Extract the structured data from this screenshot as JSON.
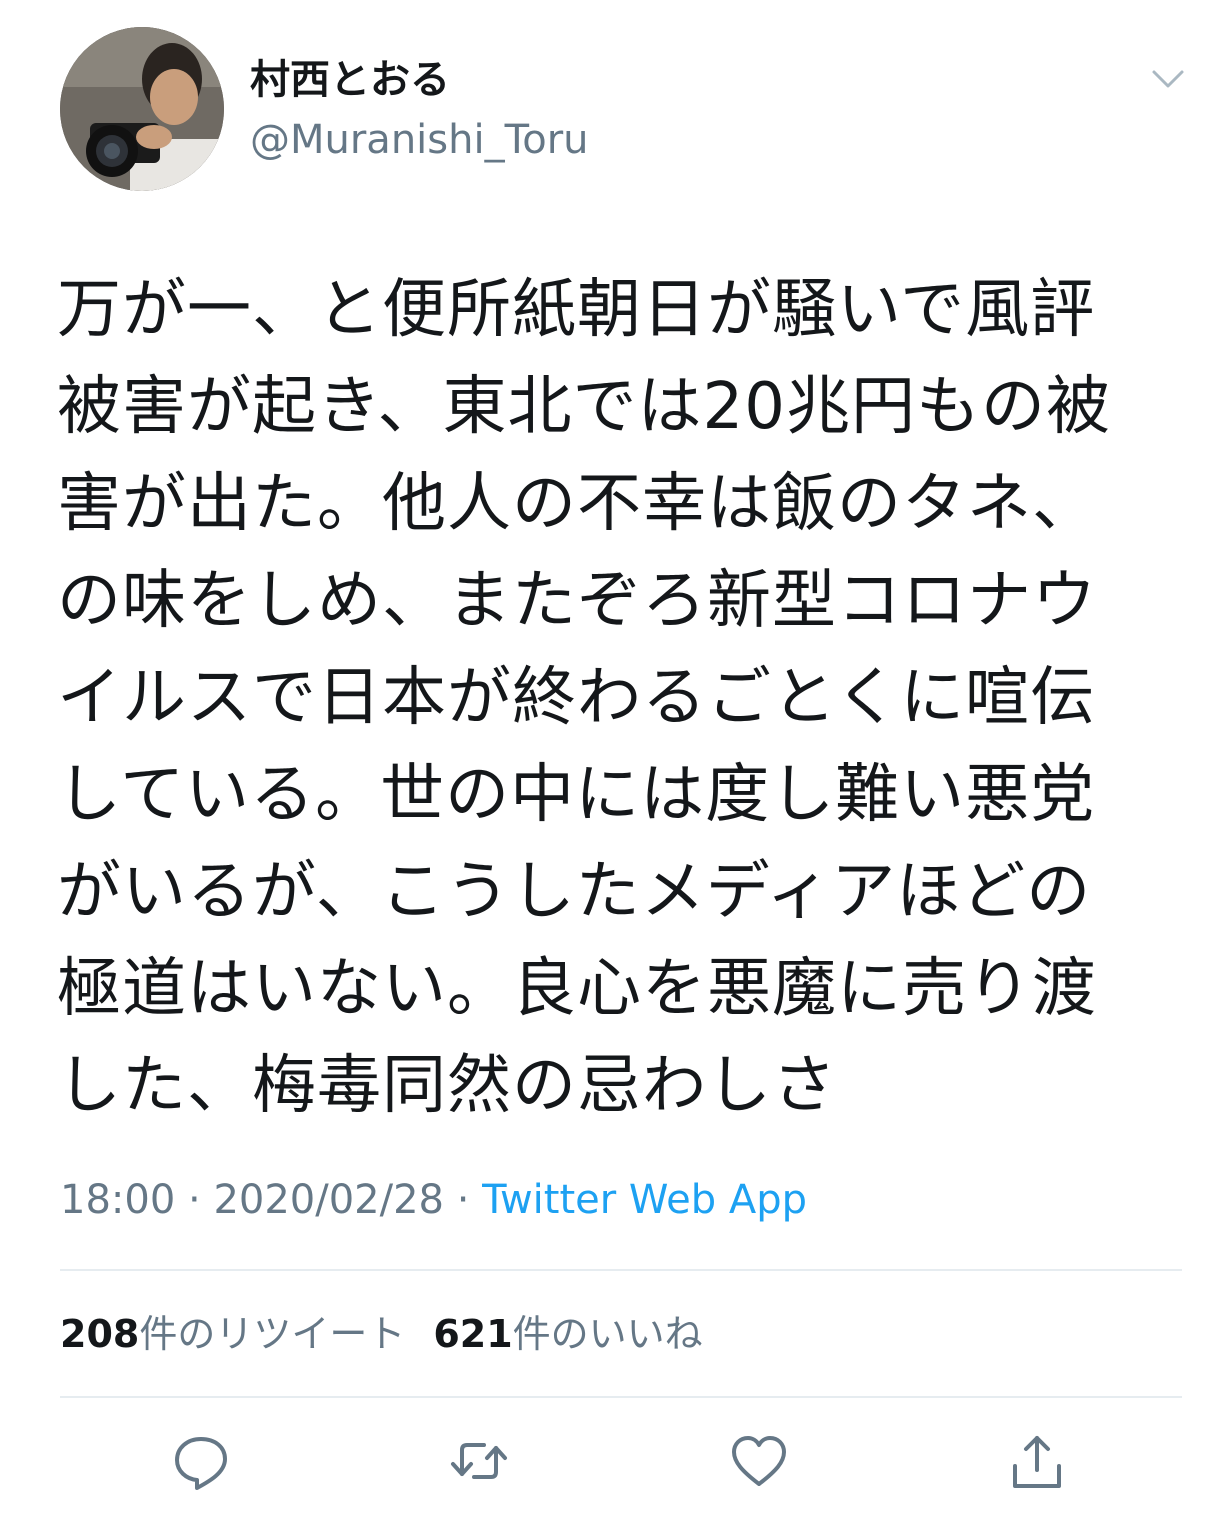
{
  "author": {
    "display_name": "村西とおる",
    "handle": "@Muranishi_Toru",
    "avatar_icon": "profile-photo-photographer-with-camera"
  },
  "menu_icon": "chevron-down-icon",
  "tweet": {
    "lines": [
      "万が一、と便所紙朝日が騒いで風評",
      "被害が起き、東北では20兆円もの被",
      "害が出た。他人の不幸は飯のタネ、",
      "の味をしめ、またぞろ新型コロナウ",
      "イルスで日本が終わるごとくに喧伝",
      "している。世の中には度し難い悪党",
      "がいるが、こうしたメディアほどの",
      "極道はいない。良心を悪魔に売り渡",
      "した、梅毒同然の忌わしさ"
    ]
  },
  "meta": {
    "time": "18:00",
    "separator": " · ",
    "date": "2020/02/28",
    "source": "Twitter Web App"
  },
  "stats": {
    "retweet_count": "208",
    "retweet_label": "件のリツイート",
    "like_count": "621",
    "like_label": "件のいいね"
  },
  "actions": [
    "reply-icon",
    "retweet-icon",
    "like-icon",
    "share-icon"
  ],
  "colors": {
    "text": "#14171a",
    "secondary": "#657786",
    "link": "#1da1f2",
    "icon": "#657786",
    "divider": "#e6ecf0"
  }
}
